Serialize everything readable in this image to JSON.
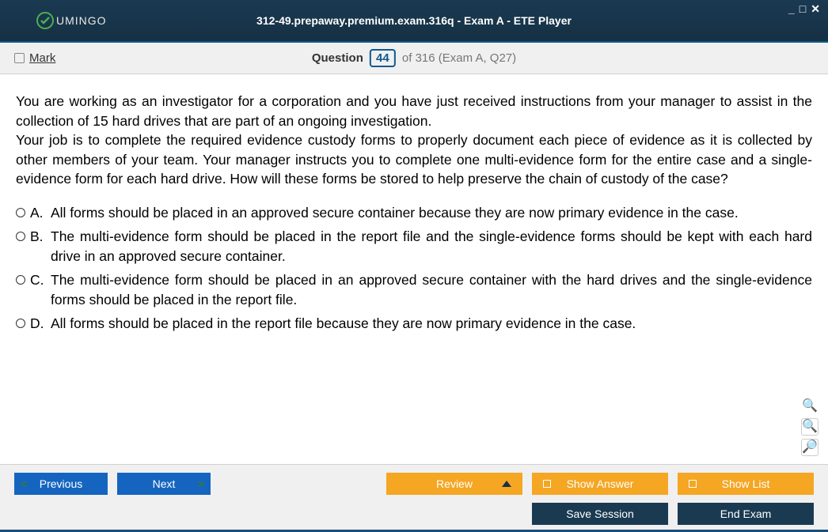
{
  "window": {
    "title": "312-49.prepaway.premium.exam.316q - Exam A - ETE Player",
    "brand": "UMINGO"
  },
  "header": {
    "mark_label": "Mark",
    "question_word": "Question",
    "question_number": "44",
    "question_rest": "of 316 (Exam A, Q27)"
  },
  "question": {
    "text_p1": "You are working as an investigator for a corporation and you have just received instructions from your manager to assist in the collection of 15 hard drives that are part of an ongoing investigation.",
    "text_p2": "Your job is to complete the required evidence custody forms to properly document each piece of evidence as it is collected by other members of your team. Your manager instructs you to complete one multi-evidence form for the entire case and a single-evidence form for each hard drive. How will these forms be stored to help preserve the chain of custody of the case?",
    "options": [
      {
        "letter": "A.",
        "text": "All forms should be placed in an approved secure container because they are now primary evidence in the case."
      },
      {
        "letter": "B.",
        "text": "The multi-evidence form should be placed in the report file and the single-evidence forms should be kept with each hard drive in an approved secure container."
      },
      {
        "letter": "C.",
        "text": "The multi-evidence form should be placed in an approved secure container with the hard drives and the single-evidence forms should be placed in the report file."
      },
      {
        "letter": "D.",
        "text": "All forms should be placed in the report file because they are now primary evidence in the case."
      }
    ]
  },
  "buttons": {
    "previous": "Previous",
    "next": "Next",
    "review": "Review",
    "show_answer": "Show Answer",
    "show_list": "Show List",
    "save_session": "Save Session",
    "end_exam": "End Exam"
  }
}
